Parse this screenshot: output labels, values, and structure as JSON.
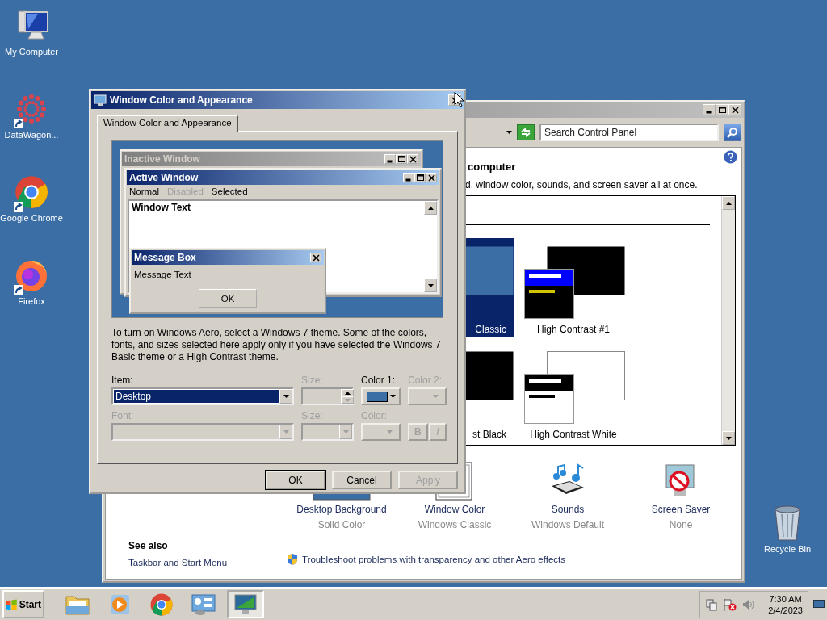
{
  "desktop_icons": [
    {
      "label": "My Computer",
      "kind": "computer"
    },
    {
      "label": "DataWagon...",
      "kind": "datawagon",
      "shortcut": true
    },
    {
      "label": "Google Chrome",
      "kind": "chrome",
      "shortcut": true
    },
    {
      "label": "Firefox",
      "kind": "firefox",
      "shortcut": true
    }
  ],
  "recycle_bin": {
    "label": "Recycle Bin"
  },
  "control_panel": {
    "search": {
      "placeholder": "Search Control Panel"
    },
    "heading": "computer",
    "description": "d, window color, sounds, and screen saver all at once.",
    "themes": [
      {
        "label": "Classic",
        "kind": "classic",
        "selected": true
      },
      {
        "label": "High Contrast #1",
        "kind": "hc1",
        "selected": false
      },
      {
        "label": "st Black",
        "kind": "black",
        "selected": false
      },
      {
        "label": "High Contrast White",
        "kind": "white",
        "selected": false
      }
    ],
    "settings": [
      {
        "label": "Desktop Background",
        "value": "Solid Color",
        "kind": "background"
      },
      {
        "label": "Window Color",
        "value": "Windows Classic",
        "kind": "window"
      },
      {
        "label": "Sounds",
        "value": "Windows Default",
        "kind": "sounds"
      },
      {
        "label": "Screen Saver",
        "value": "None",
        "kind": "screensaver"
      }
    ],
    "see_also": {
      "title": "See also",
      "links": [
        "Taskbar and Start Menu"
      ]
    },
    "troubleshoot_link": "Troubleshoot problems with transparency and other Aero effects"
  },
  "dialog": {
    "title": "Window Color and Appearance",
    "tabs": [
      {
        "label": "Window Color and Appearance",
        "selected": true
      }
    ],
    "preview": {
      "inactive_title": "Inactive Window",
      "active_title": "Active Window",
      "menu": [
        {
          "label": "Normal",
          "disabled": false
        },
        {
          "label": "Disabled",
          "disabled": true
        },
        {
          "label": "Selected",
          "disabled": false
        }
      ],
      "window_text": "Window Text",
      "message_title": "Message Box",
      "message_text": "Message Text",
      "message_button": "OK"
    },
    "note": "To turn on Windows Aero, select a Windows 7 theme.  Some of the colors, fonts, and sizes selected here apply only if you have selected the Windows 7 Basic theme or a High Contrast theme.",
    "controls": [
      {
        "label": "Item:",
        "kind": "dropdown",
        "value": "Desktop",
        "disabled": false
      },
      {
        "label": "Size:",
        "kind": "spinner",
        "disabled": true
      },
      {
        "label": "Color 1:",
        "kind": "color",
        "color": "#3a6ea5",
        "disabled": false
      },
      {
        "label": "Color 2:",
        "kind": "color",
        "disabled": true
      },
      {
        "label": "Font:",
        "kind": "dropdown",
        "disabled": true
      },
      {
        "label": "Size:",
        "kind": "dropdown",
        "disabled": true
      },
      {
        "label": "Color:",
        "kind": "color",
        "disabled": true
      }
    ],
    "style_buttons": [
      {
        "label": "B",
        "disabled": true
      },
      {
        "label": "I",
        "disabled": true
      }
    ],
    "buttons": [
      {
        "label": "OK",
        "disabled": false,
        "default": true
      },
      {
        "label": "Cancel",
        "disabled": false,
        "default": false
      },
      {
        "label": "Apply",
        "disabled": true,
        "default": false
      }
    ]
  },
  "taskbar": {
    "start": "Start",
    "items": [
      {
        "kind": "explorer",
        "selected": false
      },
      {
        "kind": "media",
        "selected": false
      },
      {
        "kind": "chrome",
        "selected": false
      },
      {
        "kind": "control-panel",
        "selected": false
      },
      {
        "kind": "display",
        "selected": true
      }
    ],
    "clock": {
      "time": "7:30 AM",
      "date": "2/4/2023"
    }
  }
}
